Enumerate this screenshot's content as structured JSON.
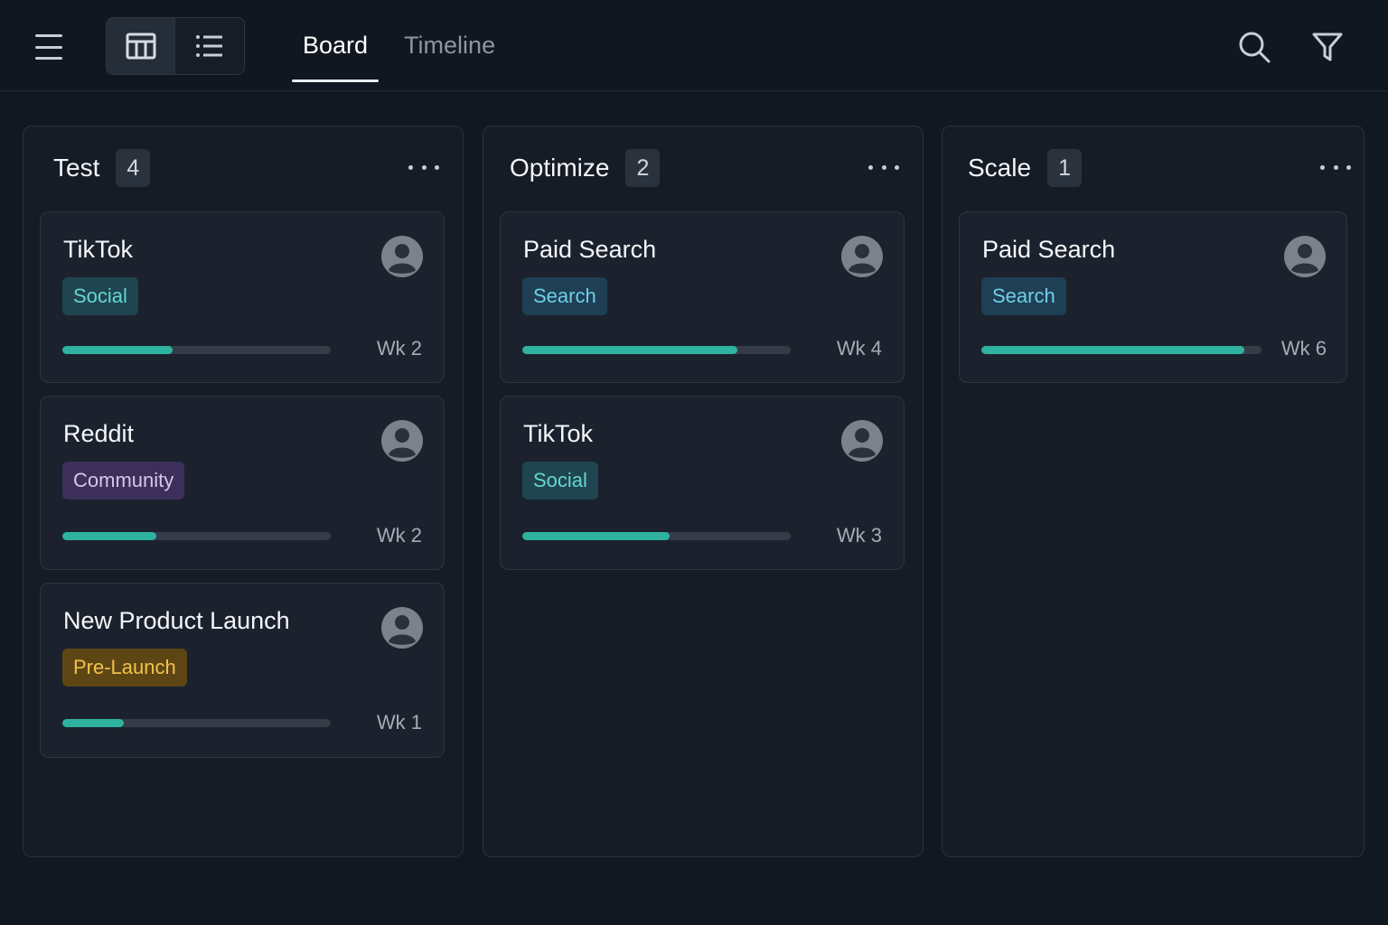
{
  "header": {
    "tabs": [
      {
        "label": "Board",
        "active": true
      },
      {
        "label": "Timeline",
        "active": false
      }
    ],
    "icons": {
      "menu": "hamburger-menu-icon",
      "board_view": "board-grid-icon",
      "list_view": "list-icon",
      "search": "search-icon",
      "filter": "filter-icon"
    }
  },
  "colors": {
    "accent": "#2fb3a0",
    "tag_social_bg": "#1f4550",
    "tag_social_text": "#66d7d1",
    "tag_search_bg": "#1f3f55",
    "tag_search_text": "#6fcfe6",
    "tag_community_bg": "#3c2f5a",
    "tag_community_text": "#d3c6ef",
    "tag_prelaunch_bg": "#5e4614",
    "tag_prelaunch_text": "#f2c24b"
  },
  "columns": [
    {
      "title": "Test",
      "count": "4",
      "cards": [
        {
          "title": "TikTok",
          "tag": "Social",
          "tag_type": "social",
          "progress": 0.41,
          "week": "Wk 2"
        },
        {
          "title": "Reddit",
          "tag": "Community",
          "tag_type": "community",
          "progress": 0.35,
          "week": "Wk 2"
        },
        {
          "title": "New Product Launch",
          "tag": "Pre-Launch",
          "tag_type": "prelaunch",
          "progress": 0.23,
          "week": "Wk 1"
        }
      ]
    },
    {
      "title": "Optimize",
      "count": "2",
      "cards": [
        {
          "title": "Paid Search",
          "tag": "Search",
          "tag_type": "search",
          "progress": 0.8,
          "week": "Wk 4"
        },
        {
          "title": "TikTok",
          "tag": "Social",
          "tag_type": "social",
          "progress": 0.55,
          "week": "Wk 3"
        }
      ]
    },
    {
      "title": "Scale",
      "count": "1",
      "cards": [
        {
          "title": "Paid Search",
          "tag": "Search",
          "tag_type": "search",
          "progress": 0.94,
          "week": "Wk 6"
        }
      ]
    }
  ]
}
